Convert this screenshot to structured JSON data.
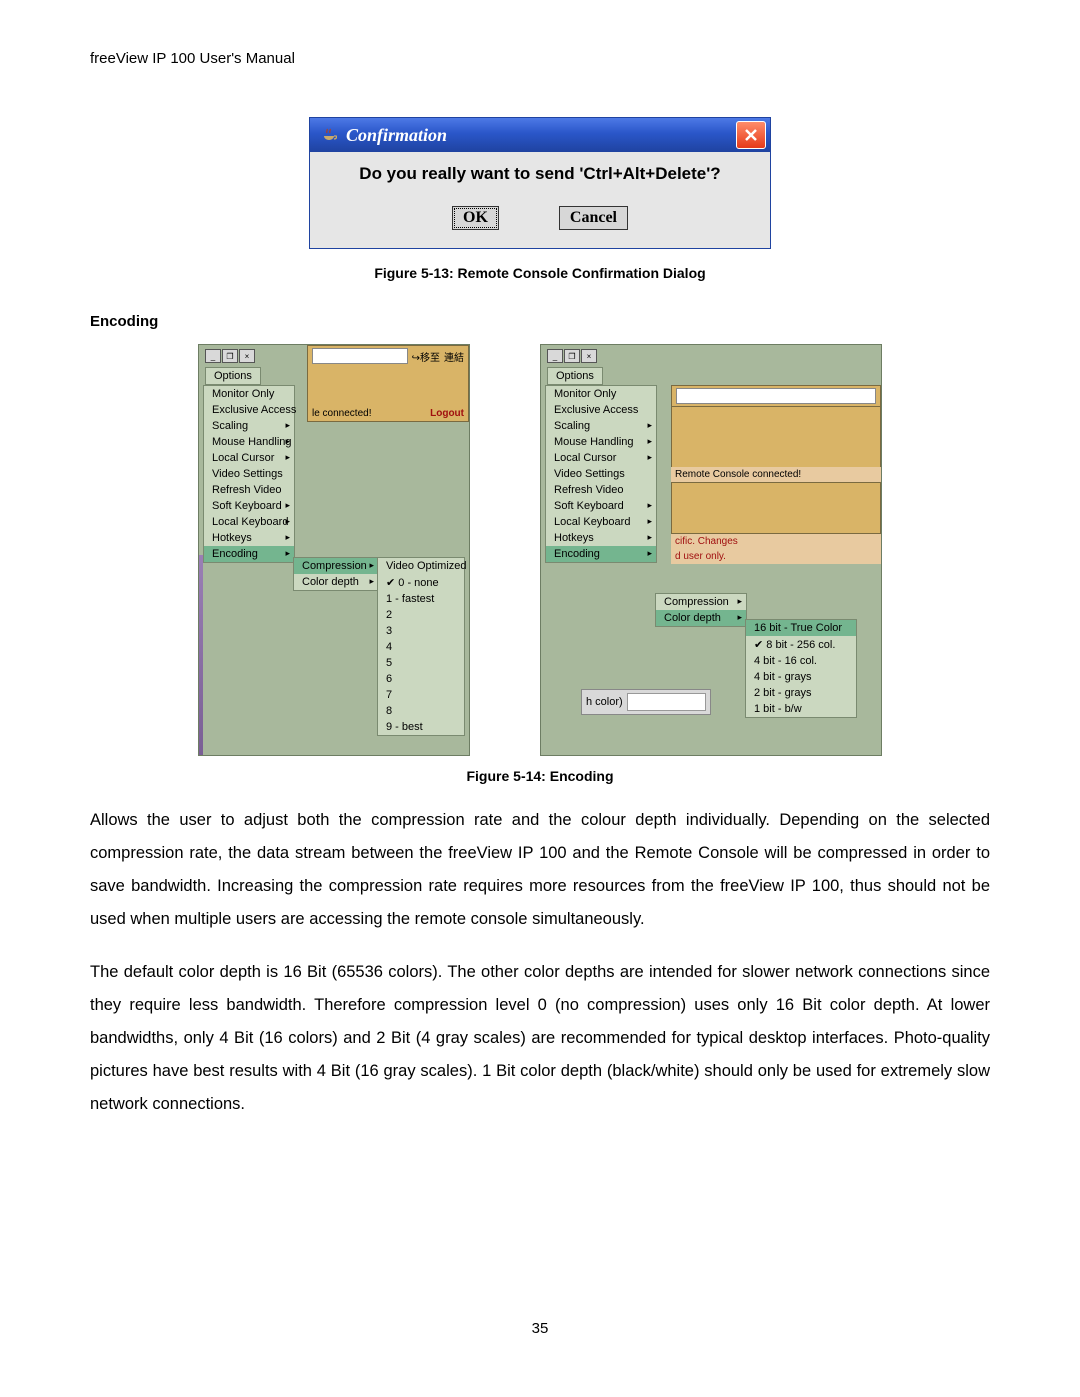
{
  "header": {
    "title": "freeView IP 100 User's Manual"
  },
  "dialog": {
    "title": "Confirmation",
    "question": "Do you really want to send 'Ctrl+Alt+Delete'?",
    "ok_label": "OK",
    "cancel_label": "Cancel"
  },
  "fig13_caption": "Figure 5-13: Remote Console Confirmation Dialog",
  "section_heading": "Encoding",
  "options_label": "Options",
  "menu_items": {
    "monitor_only": "Monitor Only",
    "exclusive_access": "Exclusive Access",
    "scaling": "Scaling",
    "mouse_handling": "Mouse Handling",
    "local_cursor": "Local Cursor",
    "video_settings": "Video Settings",
    "refresh_video": "Refresh Video",
    "soft_keyboard": "Soft Keyboard",
    "local_keyboard": "Local Keyboard",
    "hotkeys": "Hotkeys",
    "encoding": "Encoding"
  },
  "enc_submenu": {
    "compression": "Compression",
    "color_depth": "Color depth"
  },
  "compression_levels": {
    "video_optimized": "Video Optimized",
    "l0": "0 - none",
    "l1": "1 - fastest",
    "l2": "2",
    "l3": "3",
    "l4": "4",
    "l5": "5",
    "l6": "6",
    "l7": "7",
    "l8": "8",
    "l9": "9 - best"
  },
  "color_depth_levels": {
    "d16": "16 bit - True Color",
    "d8": "8 bit - 256 col.",
    "d4": "4 bit - 16 col.",
    "d4g": "4 bit - grays",
    "d2g": "2 bit - grays",
    "d1": "1 bit - b/w"
  },
  "orange_win": {
    "move_to": "移至",
    "conn_nav": "連結",
    "logout": "Logout",
    "connected": "le connected!"
  },
  "right_notice": {
    "connected": "Remote Console connected!",
    "line1": "cific. Changes",
    "line2": "d user only.",
    "h_color": "h color)"
  },
  "fig14_caption": "Figure 5-14: Encoding",
  "para1": "Allows the user to adjust both the compression rate and the colour depth individually. Depending on the selected compression rate, the data stream between the freeView IP 100 and the Remote Console will be compressed in order to save bandwidth. Increasing the compression rate requires more resources from the freeView IP 100, thus should not be used when multiple users are accessing the remote console simultaneously.",
  "para2": "The default color depth is 16 Bit (65536 colors). The other color depths are intended for slower network connections since they require less bandwidth. Therefore compression level 0 (no compression) uses only 16 Bit color depth. At lower bandwidths, only 4 Bit (16 colors) and 2 Bit (4 gray scales) are recommended for typical desktop interfaces. Photo-quality pictures have best results with 4 Bit (16 gray scales). 1 Bit color depth (black/white) should only be used for extremely slow network connections.",
  "page_number": "35"
}
